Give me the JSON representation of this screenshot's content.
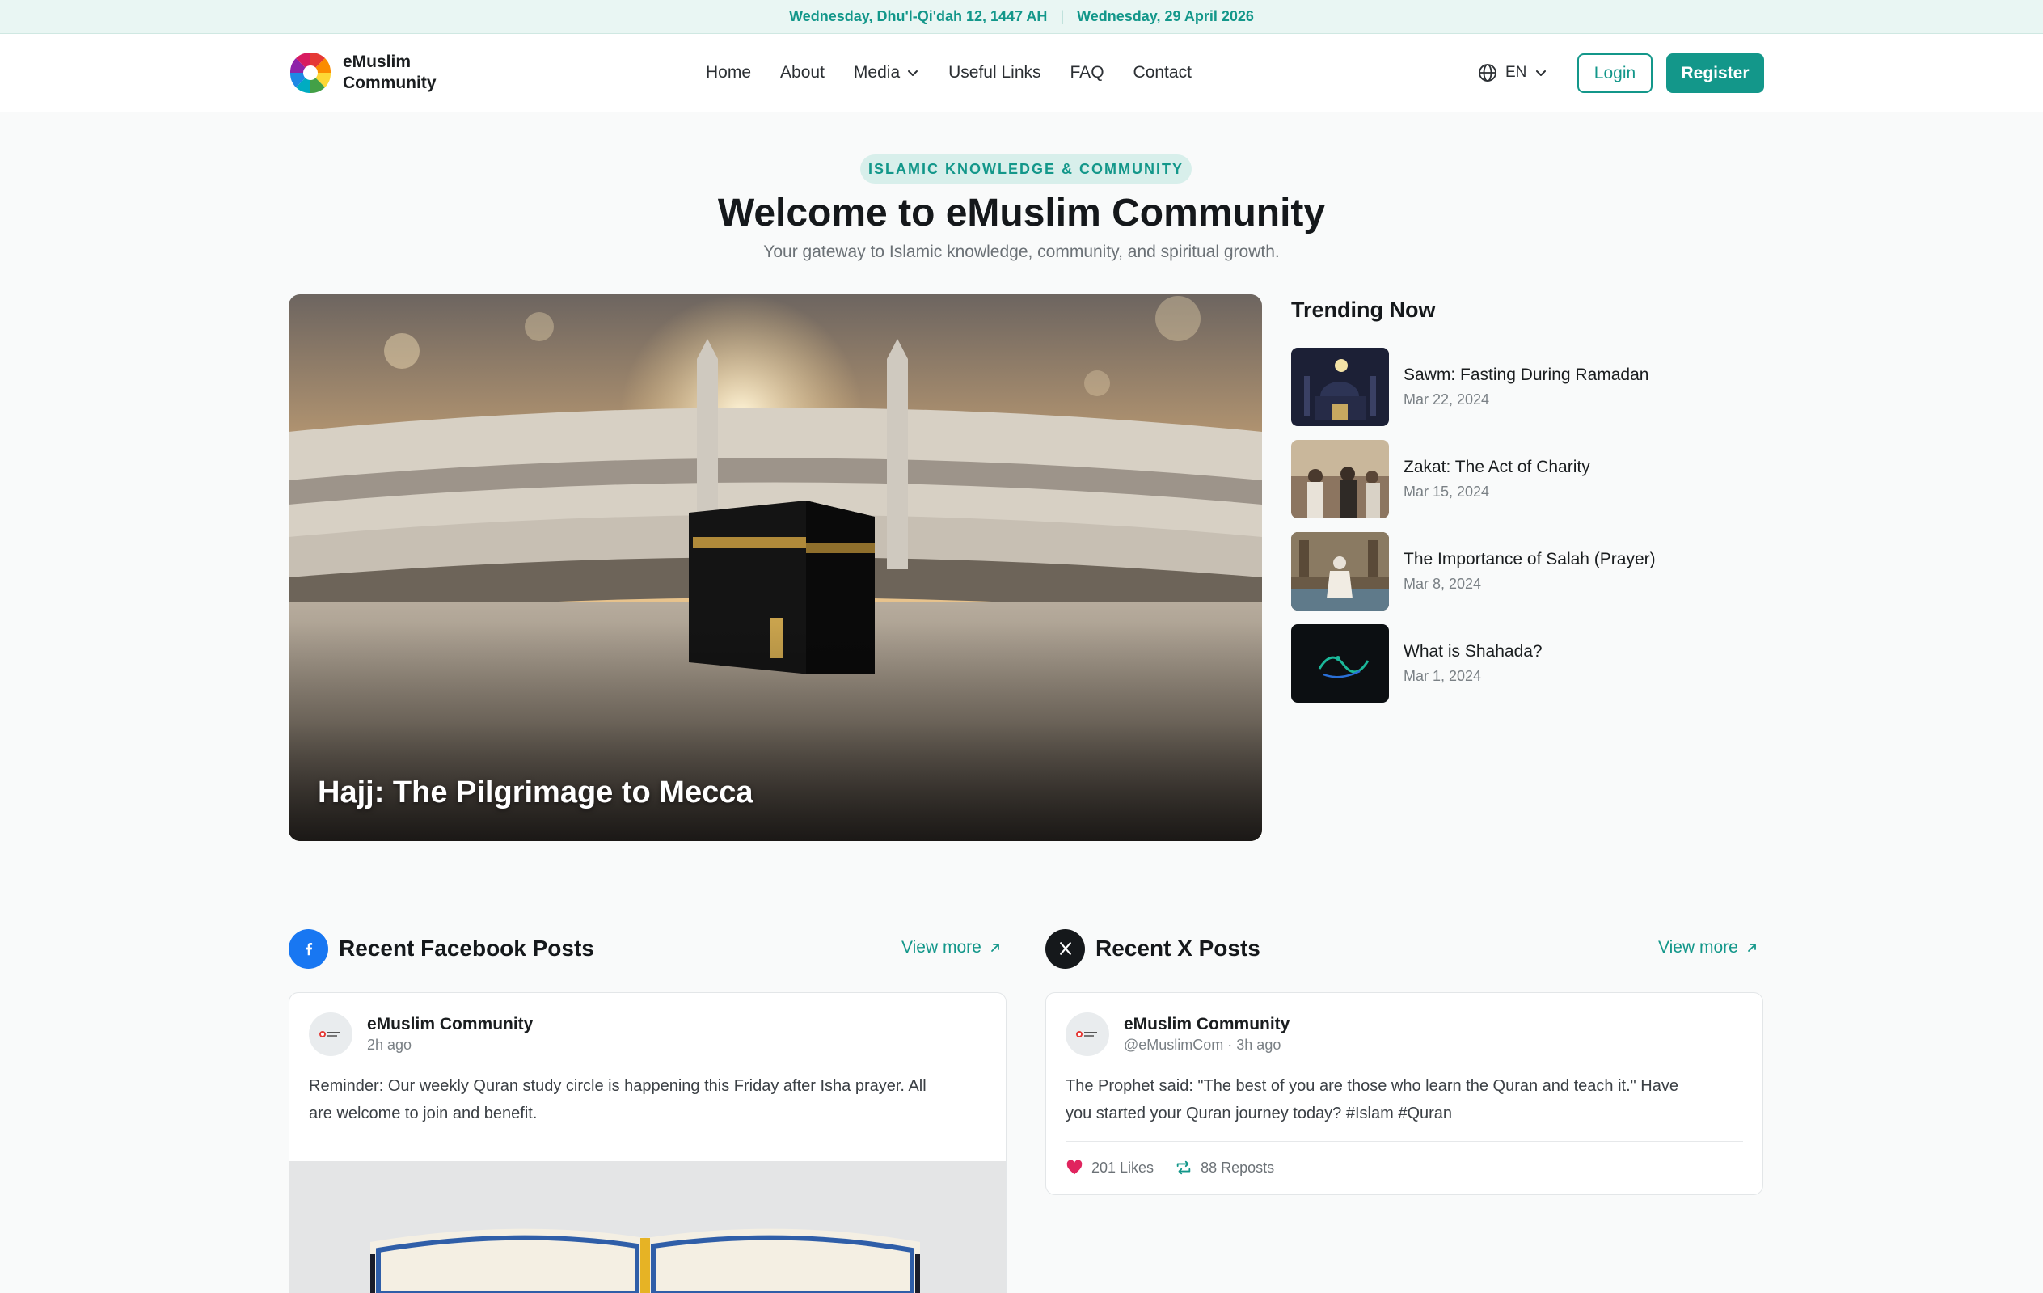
{
  "datebar": {
    "hijri": "Wednesday, Dhu'l-Qi'dah 12, 1447 AH",
    "separator": "|",
    "gregorian": "Wednesday, 29 April 2026"
  },
  "header": {
    "logo_line1": "eMuslim",
    "logo_line2": "Community",
    "nav": [
      {
        "label": "Home"
      },
      {
        "label": "About"
      },
      {
        "label": "Media"
      },
      {
        "label": "Useful Links"
      },
      {
        "label": "FAQ"
      },
      {
        "label": "Contact"
      }
    ],
    "language": "EN",
    "login": "Login",
    "register": "Register"
  },
  "hero": {
    "badge": "ISLAMIC KNOWLEDGE & COMMUNITY",
    "title": "Welcome to eMuslim Community",
    "subtitle": "Your gateway to Islamic knowledge, community, and spiritual growth."
  },
  "featured": {
    "title": "Hajj: The Pilgrimage to Mecca"
  },
  "trending": {
    "title": "Trending Now",
    "items": [
      {
        "name": "Sawm: Fasting During Ramadan",
        "date": "Mar 22, 2024"
      },
      {
        "name": "Zakat: The Act of Charity",
        "date": "Mar 15, 2024"
      },
      {
        "name": "The Importance of Salah (Prayer)",
        "date": "Mar 8, 2024"
      },
      {
        "name": "What is Shahada?",
        "date": "Mar 1, 2024"
      }
    ]
  },
  "facebook": {
    "title": "Recent Facebook Posts",
    "view_more": "View more",
    "post": {
      "author": "eMuslim Community",
      "time": "2h ago",
      "text_line1": "Reminder: Our weekly Quran study circle is happening this Friday after Isha prayer. All",
      "text_line2": "are welcome to join and benefit."
    }
  },
  "x": {
    "title": "Recent X Posts",
    "view_more": "View more",
    "post": {
      "author": "eMuslim Community",
      "handle_time": "@eMuslimCom · 3h ago",
      "text_line1": "The Prophet said: \"The best of you are those who learn the Quran and teach it.\" Have",
      "text_line2": "you started your Quran journey today? #Islam #Quran",
      "likes": "201 Likes",
      "reposts": "88 Reposts"
    }
  },
  "colors": {
    "accent": "#13978a",
    "facebook": "#1877f2",
    "like": "#e0245e"
  }
}
